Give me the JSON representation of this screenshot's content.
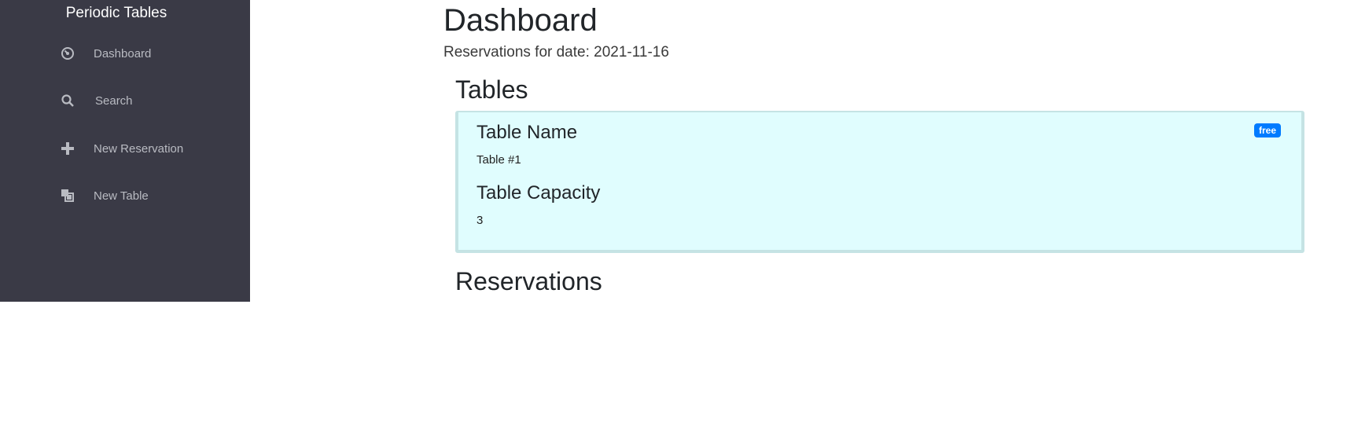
{
  "sidebar": {
    "brand": "Periodic Tables",
    "items": [
      {
        "label": "Dashboard",
        "icon": "dashboard-icon"
      },
      {
        "label": "Search",
        "icon": "search-icon"
      },
      {
        "label": "New Reservation",
        "icon": "plus-icon"
      },
      {
        "label": "New Table",
        "icon": "layers-icon"
      }
    ]
  },
  "main": {
    "title": "Dashboard",
    "date_prefix": "Reservations for date:",
    "date": "2021-11-16",
    "tables_heading": "Tables",
    "reservations_heading": "Reservations"
  },
  "table_card": {
    "name_heading": "Table Name",
    "name": "Table #1",
    "capacity_heading": "Table Capacity",
    "capacity": "3",
    "status": "free"
  },
  "colors": {
    "sidebar_bg": "#3a3a46",
    "card_bg": "#e0fdfe",
    "badge_bg": "#007bff"
  }
}
